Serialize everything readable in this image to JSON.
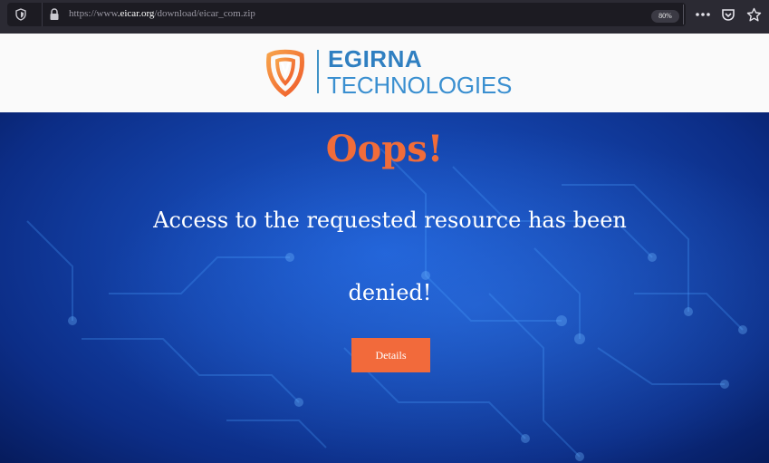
{
  "browser": {
    "url_prefix": "https://www",
    "url_domain": ".eicar.org",
    "url_path": "/download/eicar_com.zip",
    "zoom": "80%",
    "icons": [
      "shield-icon",
      "lock-icon",
      "more-icon",
      "pocket-icon",
      "bookmark-star-icon"
    ]
  },
  "header": {
    "logo_line1": "EGIRNA",
    "logo_line2": "TECHNOLOGIES",
    "colors": {
      "brand_orange": "#f26a3b",
      "brand_blue": "#2f7fc1"
    }
  },
  "hero": {
    "title": "Oops!",
    "message_line1": "Access to the requested resource has been",
    "message_line2": "denied!",
    "details_label": "Details",
    "colors": {
      "title": "#f06c3a",
      "button": "#f26a3b",
      "background": "#1444ac"
    }
  }
}
